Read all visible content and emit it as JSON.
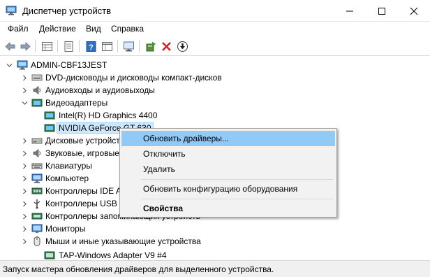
{
  "window": {
    "title": "Диспетчер устройств",
    "app_icon": "device-manager-icon"
  },
  "menu": {
    "items": [
      "Файл",
      "Действие",
      "Вид",
      "Справка"
    ]
  },
  "toolbar": {
    "buttons": [
      "back-arrow-icon",
      "forward-arrow-icon",
      "properties-grid-icon",
      "document-icon",
      "help-icon",
      "window-grid-icon",
      "monitor-icon",
      "update-driver-icon",
      "remove-x-icon",
      "download-arrow-icon"
    ]
  },
  "tree": {
    "root": "ADMIN-CBF13JEST",
    "nodes": [
      {
        "label": "DVD-дисководы и дисководы компакт-дисков",
        "icon": "dvd-drive-icon"
      },
      {
        "label": "Аудиовходы и аудиовыходы",
        "icon": "speaker-icon"
      },
      {
        "label": "Видеоадаптеры",
        "icon": "display-adapter-icon"
      },
      {
        "label": "Intel(R) HD Graphics 4400",
        "icon": "display-adapter-icon"
      },
      {
        "label": "NVIDIA GeForce GT 630",
        "icon": "display-adapter-icon"
      },
      {
        "label": "Дисковые устройства",
        "icon": "disk-drive-icon"
      },
      {
        "label": "Звуковые, игровые и видеоустройства",
        "icon": "speaker-icon"
      },
      {
        "label": "Клавиатуры",
        "icon": "keyboard-icon"
      },
      {
        "label": "Компьютер",
        "icon": "computer-icon"
      },
      {
        "label": "Контроллеры IDE ATA/ATAPI",
        "icon": "controller-icon"
      },
      {
        "label": "Контроллеры USB",
        "icon": "usb-icon"
      },
      {
        "label": "Контроллеры запоминающих устройств",
        "icon": "storage-controller-icon"
      },
      {
        "label": "Мониторы",
        "icon": "monitor-icon"
      },
      {
        "label": "Мыши и иные указывающие устройства",
        "icon": "mouse-icon"
      },
      {
        "label": "TAP-Windows Adapter V9 #4",
        "icon": "network-adapter-icon"
      }
    ]
  },
  "context_menu": {
    "items": [
      "Обновить драйверы...",
      "Отключить",
      "Удалить",
      "Обновить конфигурацию оборудования",
      "Свойства"
    ]
  },
  "status": {
    "text": "Запуск мастера обновления драйверов для выделенного устройства."
  },
  "colors": {
    "selection": "#cce8ff",
    "menu_highlight": "#91c9f7",
    "menu_bg": "#f2f2f2",
    "statusbar_bg": "#f0f0f0"
  }
}
